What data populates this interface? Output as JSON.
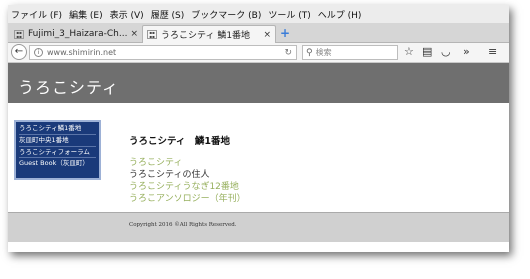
{
  "menubar": {
    "items": [
      "ファイル (F)",
      "編集 (E)",
      "表示 (V)",
      "履歴 (S)",
      "ブックマーク (B)",
      "ツール (T)",
      "ヘルプ (H)"
    ]
  },
  "tabs": [
    {
      "title": "Fujimi_3_Haizara-Ch...",
      "close": "×"
    },
    {
      "title": "うろこシティ 鱗1番地",
      "close": "×"
    }
  ],
  "newtab": "+",
  "navbar": {
    "url": "www.shimirin.net",
    "search_placeholder": "検索"
  },
  "site": {
    "title": "うろこシティ",
    "sidebar": [
      "うろこシティ鱗1番地",
      "灰皿町中央1番地",
      "うろこシティフォーラム",
      "Guest Book（灰皿町）"
    ],
    "heading": "うろこシティ　鱗1番地",
    "links": [
      {
        "text": "うろこシティ",
        "kind": "link"
      },
      {
        "text": "うろこシティの住人",
        "kind": "plain"
      },
      {
        "text": "うろこシティうなぎ12番地",
        "kind": "link"
      },
      {
        "text": "うろこアンソロジー（年刊）",
        "kind": "link"
      }
    ],
    "footer": "Copyright 2016 ©All Rights Reserved."
  },
  "colors": {
    "header_bg": "#6f6f6f",
    "sidebar_bg": "#1a3a7a",
    "link": "#97b05e",
    "footer_bg": "#d0d0d0"
  }
}
